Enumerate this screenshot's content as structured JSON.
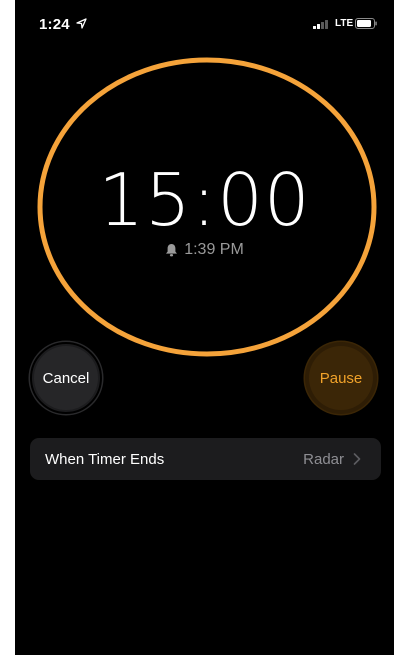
{
  "status_bar": {
    "time": "1:24",
    "location_icon": "location-arrow-icon",
    "network": "LTE",
    "battery_icon": "battery-icon",
    "signal_icon": "signal-bars-icon"
  },
  "timer": {
    "remaining": "15:00",
    "end_time": "1:39 PM",
    "bell_icon": "bell-icon",
    "ring_color": "#f5a33a",
    "progress": 1.0
  },
  "buttons": {
    "cancel_label": "Cancel",
    "pause_label": "Pause"
  },
  "settings_row": {
    "label": "When Timer Ends",
    "value": "Radar",
    "chevron_icon": "chevron-right-icon"
  },
  "colors": {
    "background": "#000000",
    "accent": "#f0a22a",
    "row_background": "#1c1c1e",
    "secondary_text": "#8e8e93"
  }
}
